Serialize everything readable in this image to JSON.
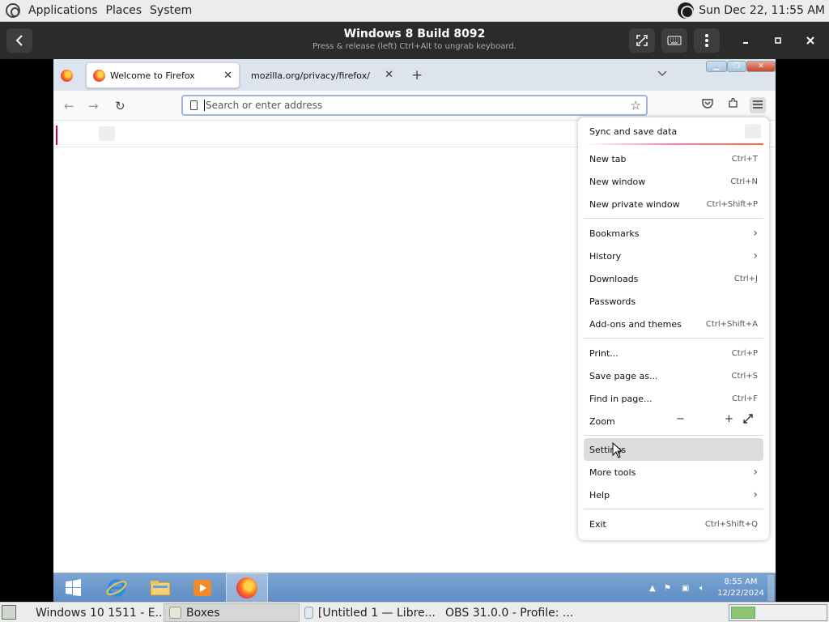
{
  "top_panel": {
    "menus": [
      "Applications",
      "Places",
      "System"
    ],
    "clock": "Sun Dec 22, 11:55 AM"
  },
  "boxes": {
    "title": "Windows 8 Build 8092",
    "hint": "Press & release (left) Ctrl+Alt to ungrab keyboard."
  },
  "firefox": {
    "tabs": [
      {
        "label": "Welcome to Firefox",
        "active": true
      },
      {
        "label": "mozilla.org/privacy/firefox/",
        "active": false
      }
    ],
    "url_placeholder": "Search or enter address",
    "menu": {
      "sync": "Sync and save data",
      "items": [
        {
          "label": "New tab",
          "shortcut": "Ctrl+T"
        },
        {
          "label": "New window",
          "shortcut": "Ctrl+N"
        },
        {
          "label": "New private window",
          "shortcut": "Ctrl+Shift+P"
        },
        {
          "label": "Bookmarks",
          "shortcut": ""
        },
        {
          "label": "History",
          "shortcut": ""
        },
        {
          "label": "Downloads",
          "shortcut": "Ctrl+J"
        },
        {
          "label": "Passwords",
          "shortcut": ""
        },
        {
          "label": "Add-ons and themes",
          "shortcut": "Ctrl+Shift+A"
        },
        {
          "label": "Print...",
          "shortcut": "Ctrl+P"
        },
        {
          "label": "Save page as...",
          "shortcut": "Ctrl+S"
        },
        {
          "label": "Find in page...",
          "shortcut": "Ctrl+F"
        },
        {
          "label": "Zoom",
          "shortcut": ""
        },
        {
          "label": "Settings",
          "shortcut": ""
        },
        {
          "label": "More tools",
          "shortcut": ""
        },
        {
          "label": "Help",
          "shortcut": ""
        },
        {
          "label": "Exit",
          "shortcut": "Ctrl+Shift+Q"
        }
      ],
      "zoom_out": "−",
      "zoom_in": "+"
    }
  },
  "win_taskbar": {
    "time": "8:55 AM",
    "date": "12/22/2024"
  },
  "host_taskbar": {
    "tasks": [
      {
        "label": "Windows 10 1511 - E...",
        "active": false
      },
      {
        "label": "Boxes",
        "active": true
      },
      {
        "label": "[Untitled 1 — Libre...",
        "active": false
      },
      {
        "label": "OBS 31.0.0 - Profile: ...",
        "active": false
      }
    ]
  },
  "colors": {
    "accent_outline": "#9fb6d9",
    "menu_hover": "#dcdcdf",
    "taskbar": "#5f8dc4"
  }
}
